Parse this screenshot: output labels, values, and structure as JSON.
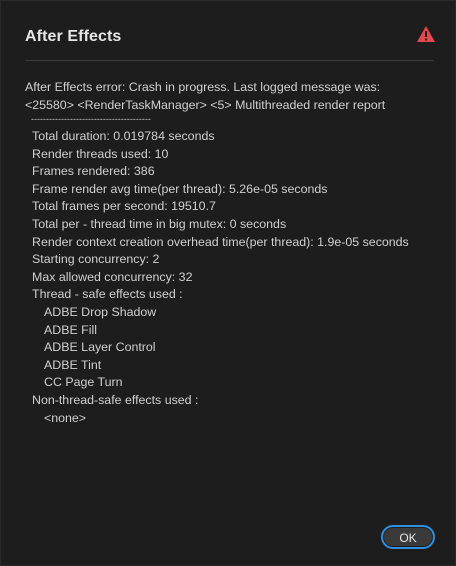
{
  "dialog": {
    "title": "After Effects",
    "icon": "warning-triangle-icon",
    "accent_color": "#2f8fe0",
    "warning_color": "#e34850"
  },
  "message": {
    "line1": "After Effects error: Crash in progress. Last logged message was:",
    "line2": "<25580> <RenderTaskManager> <5> Multithreaded render report",
    "dashes": "----------------------------------------"
  },
  "report": [
    {
      "text": "Total duration: 0.019784 seconds",
      "indent": false
    },
    {
      "text": "Render threads used: 10",
      "indent": false
    },
    {
      "text": "Frames rendered: 386",
      "indent": false
    },
    {
      "text": "Frame render avg time(per thread): 5.26e-05 seconds",
      "indent": false
    },
    {
      "text": "Total frames per second: 19510.7",
      "indent": false
    },
    {
      "text": "Total per - thread time in big mutex: 0 seconds",
      "indent": false
    },
    {
      "text": "Render context creation overhead time(per thread): 1.9e-05 seconds",
      "indent": false
    },
    {
      "text": "Starting concurrency: 2",
      "indent": false
    },
    {
      "text": "Max allowed concurrency: 32",
      "indent": false
    },
    {
      "text": "Thread - safe effects used :",
      "indent": false
    },
    {
      "text": "ADBE Drop Shadow",
      "indent": true
    },
    {
      "text": "ADBE Fill",
      "indent": true
    },
    {
      "text": "ADBE Layer Control",
      "indent": true
    },
    {
      "text": "ADBE Tint",
      "indent": true
    },
    {
      "text": "CC Page Turn",
      "indent": true
    },
    {
      "text": "Non-thread-safe effects used :",
      "indent": false
    },
    {
      "text": "<none>",
      "indent": true
    }
  ],
  "buttons": {
    "ok_label": "OK"
  }
}
